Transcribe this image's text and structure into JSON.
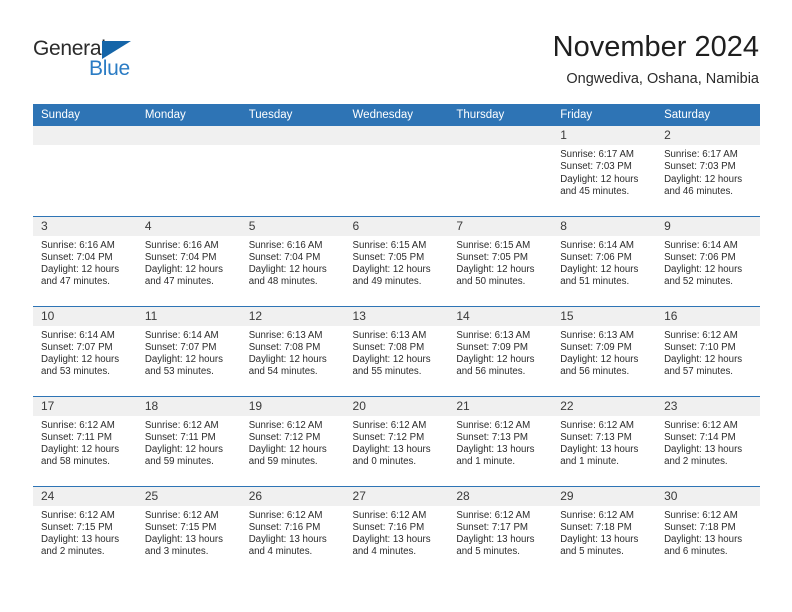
{
  "brand": {
    "name_part1": "General",
    "name_part2": "Blue",
    "color_dark": "#2b2b2b",
    "color_blue": "#2b7cc4",
    "triangle_color": "#1565a8"
  },
  "header": {
    "title": "November 2024",
    "subtitle": "Ongwediva, Oshana, Namibia"
  },
  "theme": {
    "header_row_bg": "#2e74b5",
    "daynum_bg": "#f0f0f0",
    "row_border": "#2e74b5",
    "text": "#2b2b2b"
  },
  "weekday_headers": [
    "Sunday",
    "Monday",
    "Tuesday",
    "Wednesday",
    "Thursday",
    "Friday",
    "Saturday"
  ],
  "labels": {
    "sunrise_prefix": "Sunrise:",
    "sunset_prefix": "Sunset:",
    "daylight_prefix": "Daylight:"
  },
  "weeks": [
    [
      {
        "day": "",
        "blank": true,
        "line1": "",
        "line2": "",
        "line3": "",
        "line4": ""
      },
      {
        "day": "",
        "blank": true,
        "line1": "",
        "line2": "",
        "line3": "",
        "line4": ""
      },
      {
        "day": "",
        "blank": true,
        "line1": "",
        "line2": "",
        "line3": "",
        "line4": ""
      },
      {
        "day": "",
        "blank": true,
        "line1": "",
        "line2": "",
        "line3": "",
        "line4": ""
      },
      {
        "day": "",
        "blank": true,
        "line1": "",
        "line2": "",
        "line3": "",
        "line4": ""
      },
      {
        "day": "1",
        "blank": false,
        "line1": "Sunrise: 6:17 AM",
        "line2": "Sunset: 7:03 PM",
        "line3": "Daylight: 12 hours",
        "line4": "and 45 minutes."
      },
      {
        "day": "2",
        "blank": false,
        "line1": "Sunrise: 6:17 AM",
        "line2": "Sunset: 7:03 PM",
        "line3": "Daylight: 12 hours",
        "line4": "and 46 minutes."
      }
    ],
    [
      {
        "day": "3",
        "blank": false,
        "line1": "Sunrise: 6:16 AM",
        "line2": "Sunset: 7:04 PM",
        "line3": "Daylight: 12 hours",
        "line4": "and 47 minutes."
      },
      {
        "day": "4",
        "blank": false,
        "line1": "Sunrise: 6:16 AM",
        "line2": "Sunset: 7:04 PM",
        "line3": "Daylight: 12 hours",
        "line4": "and 47 minutes."
      },
      {
        "day": "5",
        "blank": false,
        "line1": "Sunrise: 6:16 AM",
        "line2": "Sunset: 7:04 PM",
        "line3": "Daylight: 12 hours",
        "line4": "and 48 minutes."
      },
      {
        "day": "6",
        "blank": false,
        "line1": "Sunrise: 6:15 AM",
        "line2": "Sunset: 7:05 PM",
        "line3": "Daylight: 12 hours",
        "line4": "and 49 minutes."
      },
      {
        "day": "7",
        "blank": false,
        "line1": "Sunrise: 6:15 AM",
        "line2": "Sunset: 7:05 PM",
        "line3": "Daylight: 12 hours",
        "line4": "and 50 minutes."
      },
      {
        "day": "8",
        "blank": false,
        "line1": "Sunrise: 6:14 AM",
        "line2": "Sunset: 7:06 PM",
        "line3": "Daylight: 12 hours",
        "line4": "and 51 minutes."
      },
      {
        "day": "9",
        "blank": false,
        "line1": "Sunrise: 6:14 AM",
        "line2": "Sunset: 7:06 PM",
        "line3": "Daylight: 12 hours",
        "line4": "and 52 minutes."
      }
    ],
    [
      {
        "day": "10",
        "blank": false,
        "line1": "Sunrise: 6:14 AM",
        "line2": "Sunset: 7:07 PM",
        "line3": "Daylight: 12 hours",
        "line4": "and 53 minutes."
      },
      {
        "day": "11",
        "blank": false,
        "line1": "Sunrise: 6:14 AM",
        "line2": "Sunset: 7:07 PM",
        "line3": "Daylight: 12 hours",
        "line4": "and 53 minutes."
      },
      {
        "day": "12",
        "blank": false,
        "line1": "Sunrise: 6:13 AM",
        "line2": "Sunset: 7:08 PM",
        "line3": "Daylight: 12 hours",
        "line4": "and 54 minutes."
      },
      {
        "day": "13",
        "blank": false,
        "line1": "Sunrise: 6:13 AM",
        "line2": "Sunset: 7:08 PM",
        "line3": "Daylight: 12 hours",
        "line4": "and 55 minutes."
      },
      {
        "day": "14",
        "blank": false,
        "line1": "Sunrise: 6:13 AM",
        "line2": "Sunset: 7:09 PM",
        "line3": "Daylight: 12 hours",
        "line4": "and 56 minutes."
      },
      {
        "day": "15",
        "blank": false,
        "line1": "Sunrise: 6:13 AM",
        "line2": "Sunset: 7:09 PM",
        "line3": "Daylight: 12 hours",
        "line4": "and 56 minutes."
      },
      {
        "day": "16",
        "blank": false,
        "line1": "Sunrise: 6:12 AM",
        "line2": "Sunset: 7:10 PM",
        "line3": "Daylight: 12 hours",
        "line4": "and 57 minutes."
      }
    ],
    [
      {
        "day": "17",
        "blank": false,
        "line1": "Sunrise: 6:12 AM",
        "line2": "Sunset: 7:11 PM",
        "line3": "Daylight: 12 hours",
        "line4": "and 58 minutes."
      },
      {
        "day": "18",
        "blank": false,
        "line1": "Sunrise: 6:12 AM",
        "line2": "Sunset: 7:11 PM",
        "line3": "Daylight: 12 hours",
        "line4": "and 59 minutes."
      },
      {
        "day": "19",
        "blank": false,
        "line1": "Sunrise: 6:12 AM",
        "line2": "Sunset: 7:12 PM",
        "line3": "Daylight: 12 hours",
        "line4": "and 59 minutes."
      },
      {
        "day": "20",
        "blank": false,
        "line1": "Sunrise: 6:12 AM",
        "line2": "Sunset: 7:12 PM",
        "line3": "Daylight: 13 hours",
        "line4": "and 0 minutes."
      },
      {
        "day": "21",
        "blank": false,
        "line1": "Sunrise: 6:12 AM",
        "line2": "Sunset: 7:13 PM",
        "line3": "Daylight: 13 hours",
        "line4": "and 1 minute."
      },
      {
        "day": "22",
        "blank": false,
        "line1": "Sunrise: 6:12 AM",
        "line2": "Sunset: 7:13 PM",
        "line3": "Daylight: 13 hours",
        "line4": "and 1 minute."
      },
      {
        "day": "23",
        "blank": false,
        "line1": "Sunrise: 6:12 AM",
        "line2": "Sunset: 7:14 PM",
        "line3": "Daylight: 13 hours",
        "line4": "and 2 minutes."
      }
    ],
    [
      {
        "day": "24",
        "blank": false,
        "line1": "Sunrise: 6:12 AM",
        "line2": "Sunset: 7:15 PM",
        "line3": "Daylight: 13 hours",
        "line4": "and 2 minutes."
      },
      {
        "day": "25",
        "blank": false,
        "line1": "Sunrise: 6:12 AM",
        "line2": "Sunset: 7:15 PM",
        "line3": "Daylight: 13 hours",
        "line4": "and 3 minutes."
      },
      {
        "day": "26",
        "blank": false,
        "line1": "Sunrise: 6:12 AM",
        "line2": "Sunset: 7:16 PM",
        "line3": "Daylight: 13 hours",
        "line4": "and 4 minutes."
      },
      {
        "day": "27",
        "blank": false,
        "line1": "Sunrise: 6:12 AM",
        "line2": "Sunset: 7:16 PM",
        "line3": "Daylight: 13 hours",
        "line4": "and 4 minutes."
      },
      {
        "day": "28",
        "blank": false,
        "line1": "Sunrise: 6:12 AM",
        "line2": "Sunset: 7:17 PM",
        "line3": "Daylight: 13 hours",
        "line4": "and 5 minutes."
      },
      {
        "day": "29",
        "blank": false,
        "line1": "Sunrise: 6:12 AM",
        "line2": "Sunset: 7:18 PM",
        "line3": "Daylight: 13 hours",
        "line4": "and 5 minutes."
      },
      {
        "day": "30",
        "blank": false,
        "line1": "Sunrise: 6:12 AM",
        "line2": "Sunset: 7:18 PM",
        "line3": "Daylight: 13 hours",
        "line4": "and 6 minutes."
      }
    ]
  ]
}
